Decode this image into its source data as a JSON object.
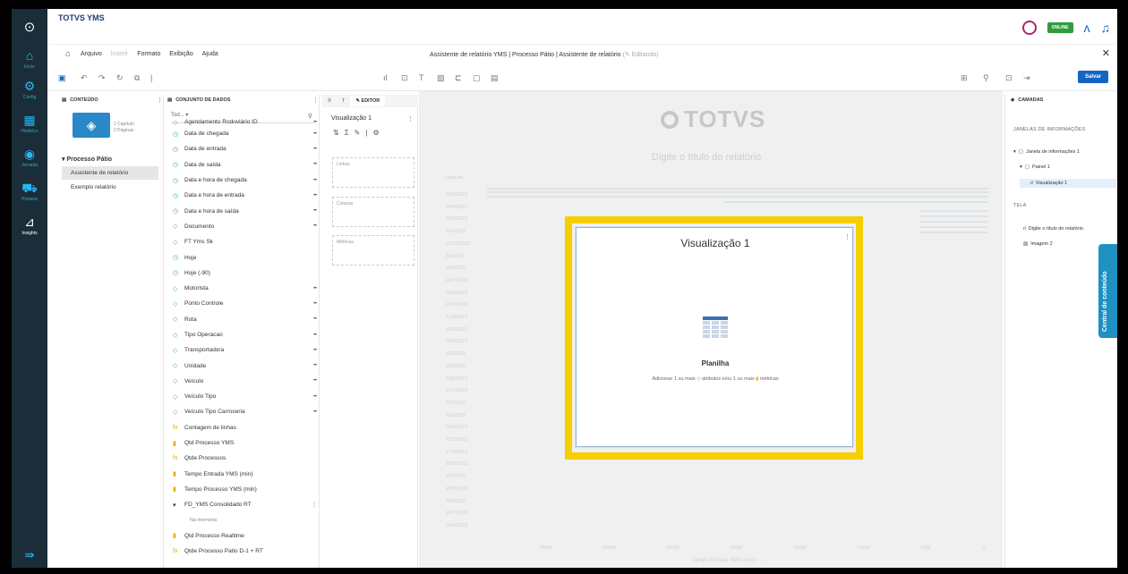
{
  "app": {
    "title": "TOTVS YMS",
    "status": "ONLINE"
  },
  "rail": [
    {
      "label": "Início",
      "icon": "home-icon",
      "glyph": "⌂"
    },
    {
      "label": "Config",
      "icon": "gear-icon",
      "glyph": "⚙"
    },
    {
      "label": "Histórico",
      "icon": "calendar-icon",
      "glyph": "▦"
    },
    {
      "label": "Jornada",
      "icon": "location-pin-icon",
      "glyph": "◉"
    },
    {
      "label": "Portaria",
      "icon": "truck-icon",
      "glyph": "⛟"
    },
    {
      "label": "Insights",
      "icon": "chart-icon",
      "glyph": "⊿"
    }
  ],
  "menu": {
    "file": "Arquivo",
    "insert": "Inserir",
    "format": "Formato",
    "view": "Exibição",
    "help": "Ajuda"
  },
  "doc": {
    "title": "Assistente de relatório YMS | Processo Pátio | Assistente de relatório",
    "state": "(✎ Editando)"
  },
  "toolbar": {
    "save": "Salvar"
  },
  "content": {
    "header": "CONTEÚDO",
    "thumb_info1": "1 Capítulo",
    "thumb_info2": "2 Páginas",
    "chapter": "▾ Processo Pátio",
    "pages": [
      "Assistente de relatório",
      "Exemplo relatório"
    ]
  },
  "dataset": {
    "header": "CONJUNTO DE DADOS",
    "search": "Tod... ▾",
    "items": [
      {
        "glyph": "◇",
        "color": "#1fb5b7",
        "label": "Agendamento Rodoviário ID",
        "dd": "• •"
      },
      {
        "glyph": "◷",
        "color": "#1fb5b7",
        "label": "Data de chegada",
        "dd": "• •"
      },
      {
        "glyph": "◷",
        "color": "#1fb5b7",
        "label": "Data de entrada",
        "dd": "• •"
      },
      {
        "glyph": "◷",
        "color": "#1fb5b7",
        "label": "Data de saída",
        "dd": "• •"
      },
      {
        "glyph": "◷",
        "color": "#1fb5b7",
        "label": "Data e hora de chegada",
        "dd": "• •"
      },
      {
        "glyph": "◷",
        "color": "#1fb5b7",
        "label": "Data e hora de entrada",
        "dd": "• •"
      },
      {
        "glyph": "◷",
        "color": "#1fb5b7",
        "label": "Data e hora de saída",
        "dd": "• •"
      },
      {
        "glyph": "◇",
        "color": "#1fb5b7",
        "label": "Documento",
        "dd": "• •"
      },
      {
        "glyph": "◇",
        "color": "#1fb5b7",
        "label": "FT Yms Sk",
        "dd": ""
      },
      {
        "glyph": "◷",
        "color": "#1fb5b7",
        "label": "Hoje",
        "dd": ""
      },
      {
        "glyph": "◷",
        "color": "#1fb5b7",
        "label": "Hoje (-90)",
        "dd": ""
      },
      {
        "glyph": "◇",
        "color": "#1fb5b7",
        "label": "Motorista",
        "dd": "• •"
      },
      {
        "glyph": "◇",
        "color": "#1fb5b7",
        "label": "Ponto Controle",
        "dd": "• •"
      },
      {
        "glyph": "◇",
        "color": "#1fb5b7",
        "label": "Rota",
        "dd": "• •"
      },
      {
        "glyph": "◇",
        "color": "#1fb5b7",
        "label": "Tipo Operacao",
        "dd": "• •"
      },
      {
        "glyph": "◇",
        "color": "#1fb5b7",
        "label": "Transportadora",
        "dd": "• •"
      },
      {
        "glyph": "◇",
        "color": "#1fb5b7",
        "label": "Unidade",
        "dd": "• •"
      },
      {
        "glyph": "◇",
        "color": "#1fb5b7",
        "label": "Veículo",
        "dd": "• •"
      },
      {
        "glyph": "◇",
        "color": "#1fb5b7",
        "label": "Veículo Tipo",
        "dd": "• •"
      },
      {
        "glyph": "◇",
        "color": "#1fb5b7",
        "label": "Veículo Tipo Carroceria",
        "dd": "• •"
      },
      {
        "glyph": "fx",
        "color": "#f4a80c",
        "label": "Contagem de linhas",
        "dd": ""
      },
      {
        "glyph": "▮",
        "color": "#f4a80c",
        "label": "Qtd Processo YMS",
        "dd": ""
      },
      {
        "glyph": "fx",
        "color": "#f4a80c",
        "label": "Qtde Processos",
        "dd": ""
      },
      {
        "glyph": "▮",
        "color": "#f4a80c",
        "label": "Tempo Entrada YMS (min)",
        "dd": ""
      },
      {
        "glyph": "▮",
        "color": "#f4a80c",
        "label": "Tempo Processo YMS (min)",
        "dd": ""
      },
      {
        "glyph": "▾",
        "color": "#333333",
        "label": "FD_YMS Consolidado RT",
        "dd": "⋮"
      },
      {
        "glyph": "",
        "color": "#888888",
        "label": "Na memória",
        "dd": ""
      },
      {
        "glyph": "▮",
        "color": "#f4a80c",
        "label": "Qtd Processo Realtime",
        "dd": ""
      },
      {
        "glyph": "fx",
        "color": "#f4a80c",
        "label": "Qtde Processo Patio D-1 + RT",
        "dd": ""
      }
    ]
  },
  "editor": {
    "tab_editor": "✎ EDITOR",
    "viz_name": "Visualização 1",
    "zones": [
      "Linhas",
      "Colunas",
      "Métricas"
    ]
  },
  "canvas": {
    "brand": "TOTVS",
    "title_placeholder": "Digite o título do relatório",
    "y_header": "Data de...",
    "y_labels": [
      "22/8/2023",
      "24/8/2023",
      "19/8/2023",
      "5/7/2023",
      "22/12/2022",
      "3/8/2023",
      "4/8/2023",
      "28/7/2023",
      "25/8/2023",
      "22/5/2023",
      "12/8/2023",
      "16/8/2023",
      "10/8/2023",
      "2/5/2023",
      "8/8/2023",
      "13/6/2023",
      "19/7/2023",
      "6/7/2023",
      "1/6/2023",
      "20/6/2023",
      "12/7/2023",
      "17/8/2023",
      "22/8/2023",
      "9/7/2023",
      "29/5/2023",
      "4/8/2023",
      "24/7/2023",
      "25/4/2023"
    ],
    "x_labels": [
      "-350M",
      "-300M",
      "-250M",
      "-200M",
      "-150M",
      "-100M",
      "-50M",
      "0"
    ],
    "x_title": "Tempo Entrada YMS (min) ↑↓",
    "viz_title": "Visualização 1",
    "placeholder_title": "Planilha",
    "hint_a": "Adicionar 1 ou mais",
    "hint_b": "atributos e/ou 1 ou mais",
    "hint_c": "métricas"
  },
  "layers": {
    "header": "CAMADAS",
    "section1": "JANELAS DE INFORMAÇÕES",
    "window": "Janela de informações 1",
    "panel": "Painel 1",
    "viz": "Visualização 1",
    "section2": "TELA",
    "t1": "Digite o título do relatório",
    "t2": "Imagem 2"
  },
  "side_tab": "Central de conteúdo"
}
